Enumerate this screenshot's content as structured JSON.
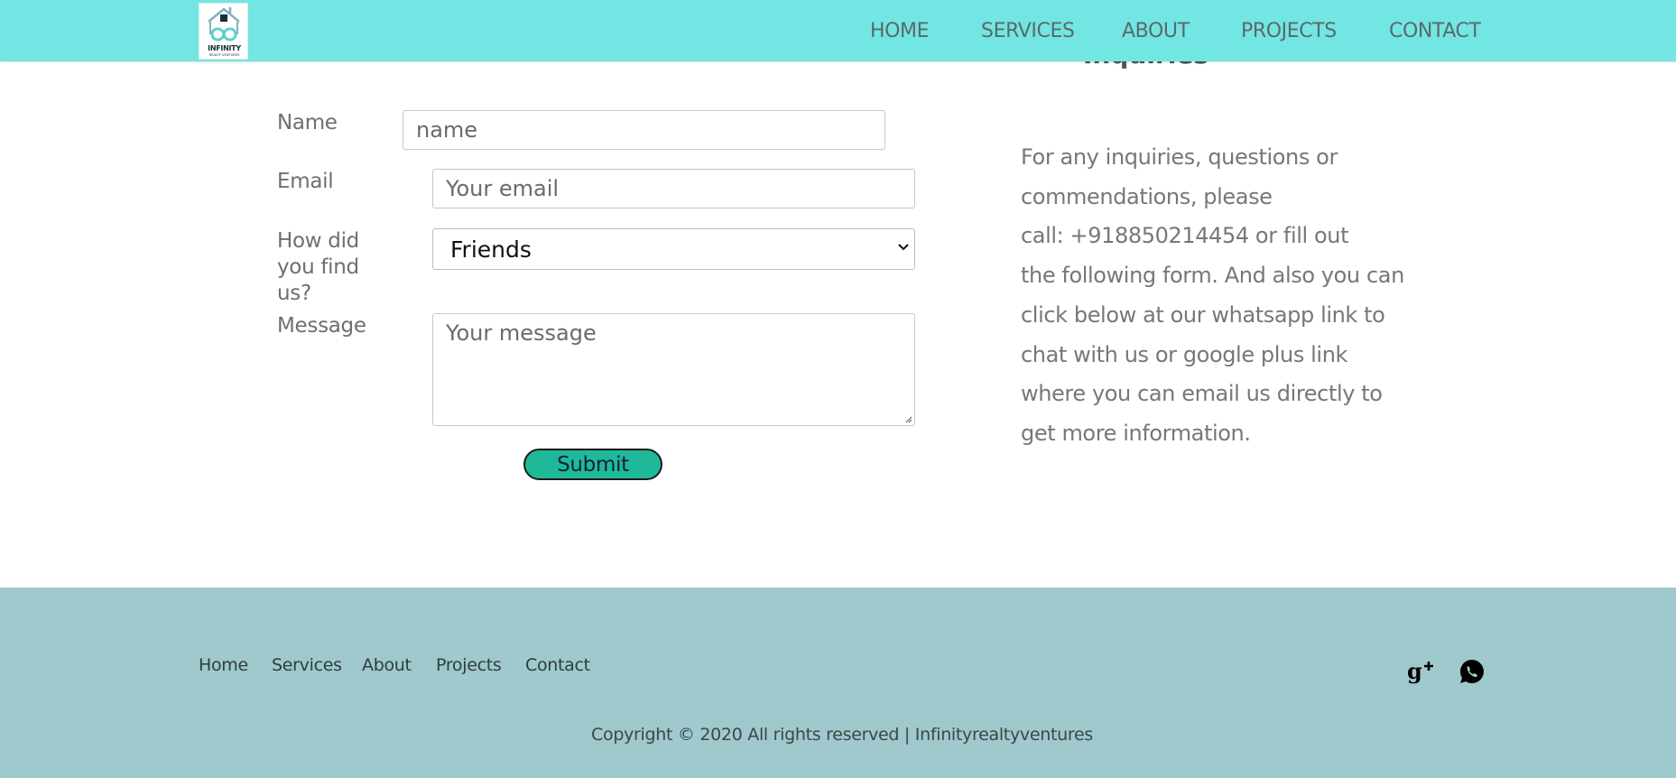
{
  "brand": {
    "logo_text": "INFINITY",
    "logo_subtext": "REALTY VENTURES"
  },
  "nav": {
    "items": [
      "HOME",
      "SERVICES",
      "ABOUT",
      "PROJECTS",
      "CONTACT"
    ]
  },
  "section": {
    "heading": "Inquiries"
  },
  "form": {
    "name_label": "Name",
    "name_placeholder": "name",
    "email_label": "Email",
    "email_placeholder": "Your email",
    "source_label_lines": [
      "How did",
      "you find",
      "us?"
    ],
    "source_selected": "Friends",
    "message_label": "Message",
    "message_placeholder": "Your message",
    "submit_label": "Submit"
  },
  "info": {
    "lines": [
      "For any inquiries, questions or",
      "commendations, please",
      "call: +918850214454 or fill out",
      "the following form. And also you can",
      "click below at our whatsapp link to",
      "chat with us or google plus link",
      "where you can email us directly to",
      "get more information."
    ]
  },
  "footer": {
    "links": [
      "Home",
      "Services",
      "About",
      "Projects",
      "Contact"
    ],
    "copyright": "Copyright © 2020 All rights reserved | Infinityrealtyventures",
    "social": [
      "google-plus-icon",
      "whatsapp-icon"
    ]
  },
  "colors": {
    "header_bg": "#72e6e3",
    "footer_bg": "#9fc9cc",
    "submit_bg": "#1fb99a"
  }
}
